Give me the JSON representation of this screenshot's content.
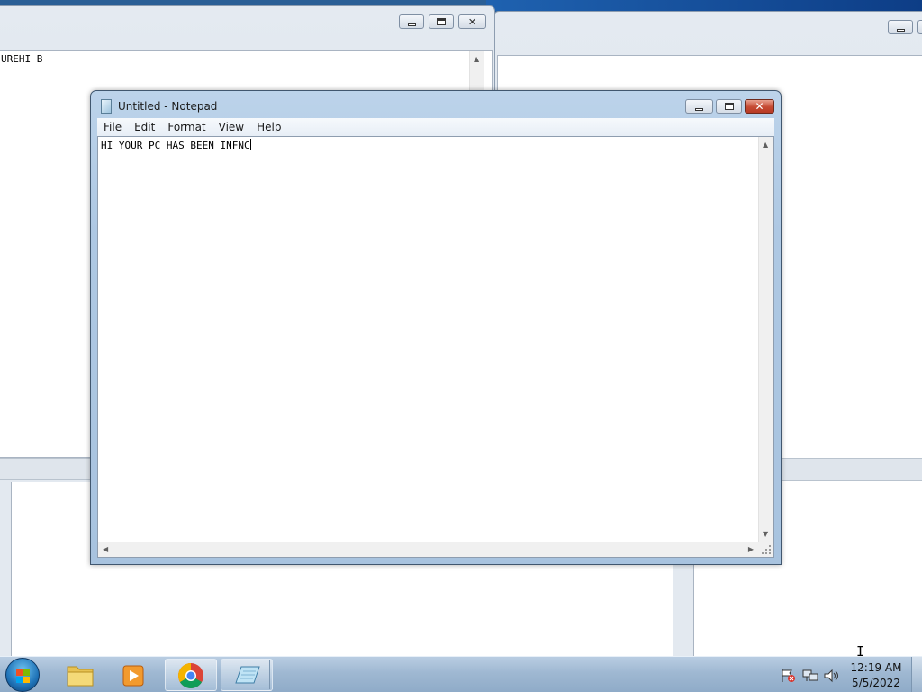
{
  "background_window_left": {
    "text": "UREHI B"
  },
  "notepad": {
    "title": "Untitled - Notepad",
    "menu": [
      "File",
      "Edit",
      "Format",
      "View",
      "Help"
    ],
    "content": "HI YOUR PC HAS BEEN INFNC"
  },
  "taskbar": {
    "pinned": [
      "windows-explorer",
      "media-player",
      "chrome",
      "notepad"
    ],
    "clock_time": "12:19 AM",
    "clock_date": "5/5/2022"
  },
  "colors": {
    "accent": "#aec8e3",
    "close_button": "#c64a33",
    "taskbar": "#9fb8d2"
  }
}
